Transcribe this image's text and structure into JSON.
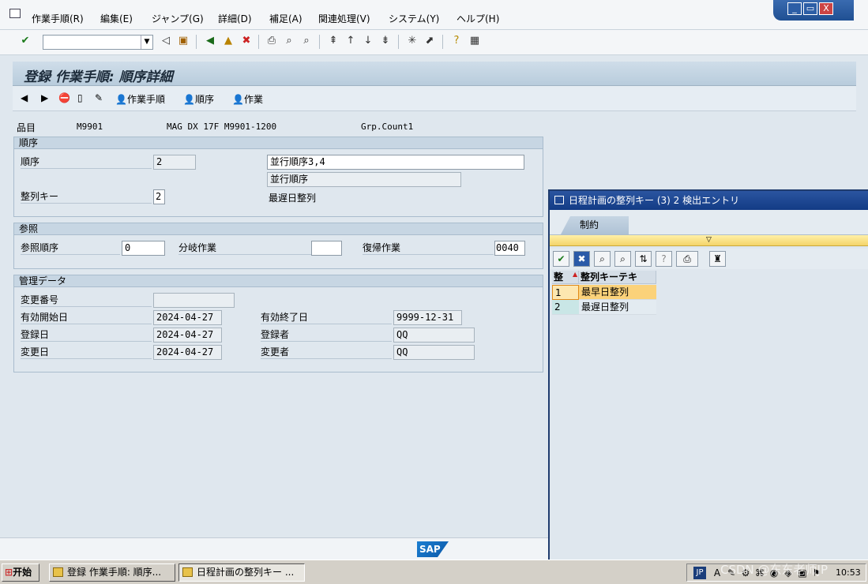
{
  "menu": {
    "items": [
      "作業手順(R)",
      "編集(E)",
      "ジャンプ(G)",
      "詳細(D)",
      "補足(A)",
      "関連処理(V)",
      "システム(Y)",
      "ヘルプ(H)"
    ]
  },
  "window": {
    "min": "_",
    "restore": "▭",
    "close": "X"
  },
  "toolbar": {
    "command_value": ""
  },
  "title": "登録 作業手順: 順序詳細",
  "apptoolbar": {
    "routing_label": "作業手順",
    "sequence_label": "順序",
    "operation_label": "作業"
  },
  "header": {
    "material_label": "品目",
    "material_value": "M9901",
    "material_desc": "MAG DX 17F M9901-1200",
    "group_counter": "Grp.Count1"
  },
  "sequence": {
    "title": "順序",
    "seq_label": "順序",
    "seq_value": "2",
    "desc_value": "並行順序3,4",
    "type_value": "並行順序",
    "alignkey_label": "整列キー",
    "alignkey_value": "2",
    "alignkey_text": "最遅日整列"
  },
  "reference": {
    "title": "参照",
    "ref_seq_label": "参照順序",
    "ref_seq_value": "0",
    "branch_label": "分岐作業",
    "branch_value": "",
    "return_label": "復帰作業",
    "return_value": "0040"
  },
  "admin": {
    "title": "管理データ",
    "change_no_label": "変更番号",
    "change_no_value": "",
    "valid_from_label": "有効開始日",
    "valid_from_value": "2024-04-27",
    "valid_to_label": "有効終了日",
    "valid_to_value": "9999-12-31",
    "created_label": "登録日",
    "created_value": "2024-04-27",
    "created_by_label": "登録者",
    "created_by_value": "QQ",
    "changed_label": "変更日",
    "changed_value": "2024-04-27",
    "changed_by_label": "変更者",
    "changed_by_value": "QQ"
  },
  "popup": {
    "title": "日程計画の整列キー (3)    2 検出エントリ",
    "tab_label": "制約",
    "col1": "整",
    "col2": "整列キーテキ",
    "rows": [
      {
        "key": "1",
        "text": "最早日整列"
      },
      {
        "key": "2",
        "text": "最遅日整列"
      }
    ]
  },
  "taskbar": {
    "start": "开始",
    "task1": "登録 作業手順: 順序...",
    "task2": "日程計画の整列キー ...",
    "lang": "JP",
    "time": "10:53"
  },
  "watermark": "CSDN @东东老师JP",
  "footer": {
    "sap": "SAP"
  }
}
